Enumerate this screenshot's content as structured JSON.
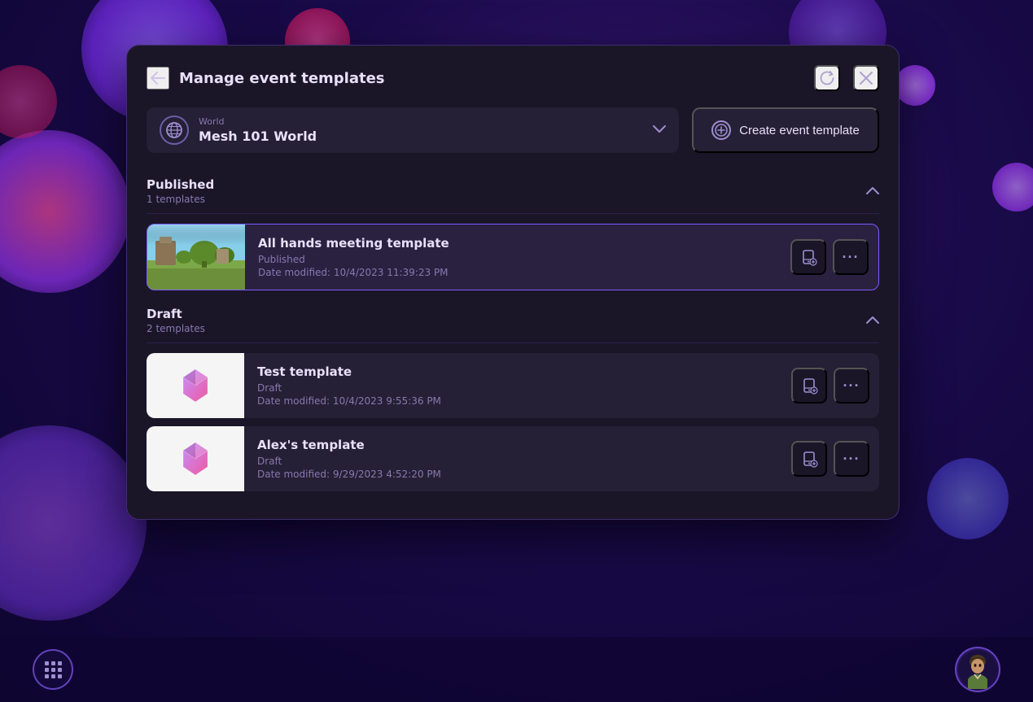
{
  "background": {
    "color": "#1a0a4a"
  },
  "modal": {
    "title": "Manage event templates",
    "back_label": "←",
    "refresh_label": "↺",
    "close_label": "✕"
  },
  "world_selector": {
    "label": "World",
    "name": "Mesh 101 World",
    "chevron": "∨"
  },
  "create_button": {
    "label": "Create event template",
    "icon": "+"
  },
  "sections": [
    {
      "id": "published",
      "title": "Published",
      "count": "1 templates",
      "expanded": true,
      "toggle_icon": "∧",
      "items": [
        {
          "id": "all-hands",
          "name": "All hands meeting template",
          "status": "Published",
          "date": "Date modified: 10/4/2023 11:39:23 PM",
          "thumbnail_type": "outdoor",
          "selected": true
        }
      ]
    },
    {
      "id": "draft",
      "title": "Draft",
      "count": "2 templates",
      "expanded": true,
      "toggle_icon": "∧",
      "items": [
        {
          "id": "test-template",
          "name": "Test template",
          "status": "Draft",
          "date": "Date modified: 10/4/2023 9:55:36 PM",
          "thumbnail_type": "mesh",
          "selected": false
        },
        {
          "id": "alexs-template",
          "name": "Alex's template",
          "status": "Draft",
          "date": "Date modified: 9/29/2023 4:52:20 PM",
          "thumbnail_type": "mesh",
          "selected": false
        }
      ]
    }
  ],
  "bottom_bar": {
    "grid_icon": "⊞",
    "avatar_color": "#2d1b69"
  },
  "icons": {
    "back": "←",
    "refresh": "↺",
    "close": "✕",
    "globe": "🌐",
    "chevron_down": "⌄",
    "chevron_up": "⌃",
    "plus_circle": "+",
    "device": "📱",
    "more": "···"
  }
}
